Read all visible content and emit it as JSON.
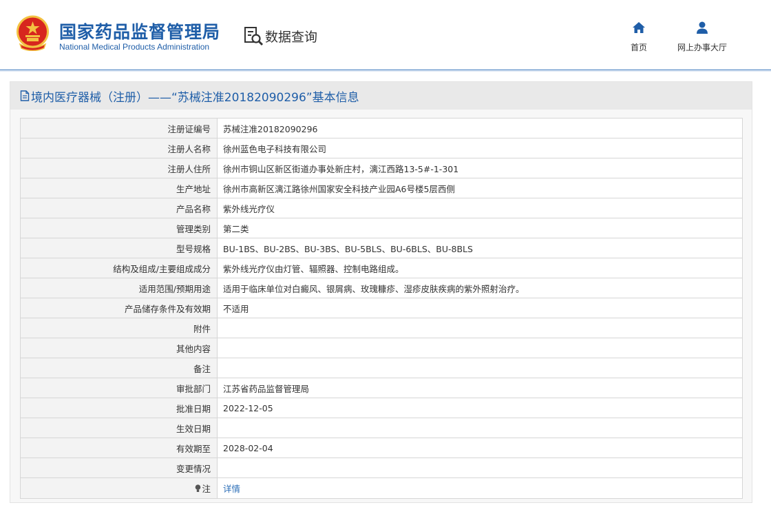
{
  "header": {
    "logo_cn": "国家药品监督管理局",
    "logo_en": "National Medical Products Administration",
    "query_label": "数据查询",
    "nav": [
      {
        "label": "首页",
        "icon": "home-icon"
      },
      {
        "label": "网上办事大厅",
        "icon": "user-icon"
      }
    ]
  },
  "panel": {
    "title": "境内医疗器械（注册）——“苏械注准20182090296”基本信息"
  },
  "rows": [
    {
      "key": "注册证编号",
      "value": "苏械注准20182090296"
    },
    {
      "key": "注册人名称",
      "value": "徐州蓝色电子科技有限公司"
    },
    {
      "key": "注册人住所",
      "value": "徐州市铜山区新区街道办事处新庄村，漓江西路13-5#-1-301"
    },
    {
      "key": "生产地址",
      "value": "徐州市高新区漓江路徐州国家安全科技产业园A6号楼5层西侧"
    },
    {
      "key": "产品名称",
      "value": "紫外线光疗仪"
    },
    {
      "key": "管理类别",
      "value": "第二类"
    },
    {
      "key": "型号规格",
      "value": "BU-1BS、BU-2BS、BU-3BS、BU-5BLS、BU-6BLS、BU-8BLS"
    },
    {
      "key": "结构及组成/主要组成成分",
      "value": "紫外线光疗仪由灯管、辐照器、控制电路组成。"
    },
    {
      "key": "适用范围/预期用途",
      "value": "适用于临床单位对白癜风、银屑病、玫瑰糠疹、湿疹皮肤疾病的紫外照射治疗。"
    },
    {
      "key": "产品储存条件及有效期",
      "value": "不适用"
    },
    {
      "key": "附件",
      "value": ""
    },
    {
      "key": "其他内容",
      "value": ""
    },
    {
      "key": "备注",
      "value": ""
    },
    {
      "key": "审批部门",
      "value": "江苏省药品监督管理局"
    },
    {
      "key": "批准日期",
      "value": "2022-12-05"
    },
    {
      "key": "生效日期",
      "value": ""
    },
    {
      "key": "有效期至",
      "value": "2028-02-04"
    },
    {
      "key": "变更情况",
      "value": ""
    }
  ],
  "note_row": {
    "key": "注",
    "link": "详情",
    "icon": "bulb-icon"
  },
  "colors": {
    "brand": "#1f5ea8",
    "link": "#2d6fb8",
    "emblem_red": "#d7261e",
    "emblem_gold": "#f3c242"
  }
}
